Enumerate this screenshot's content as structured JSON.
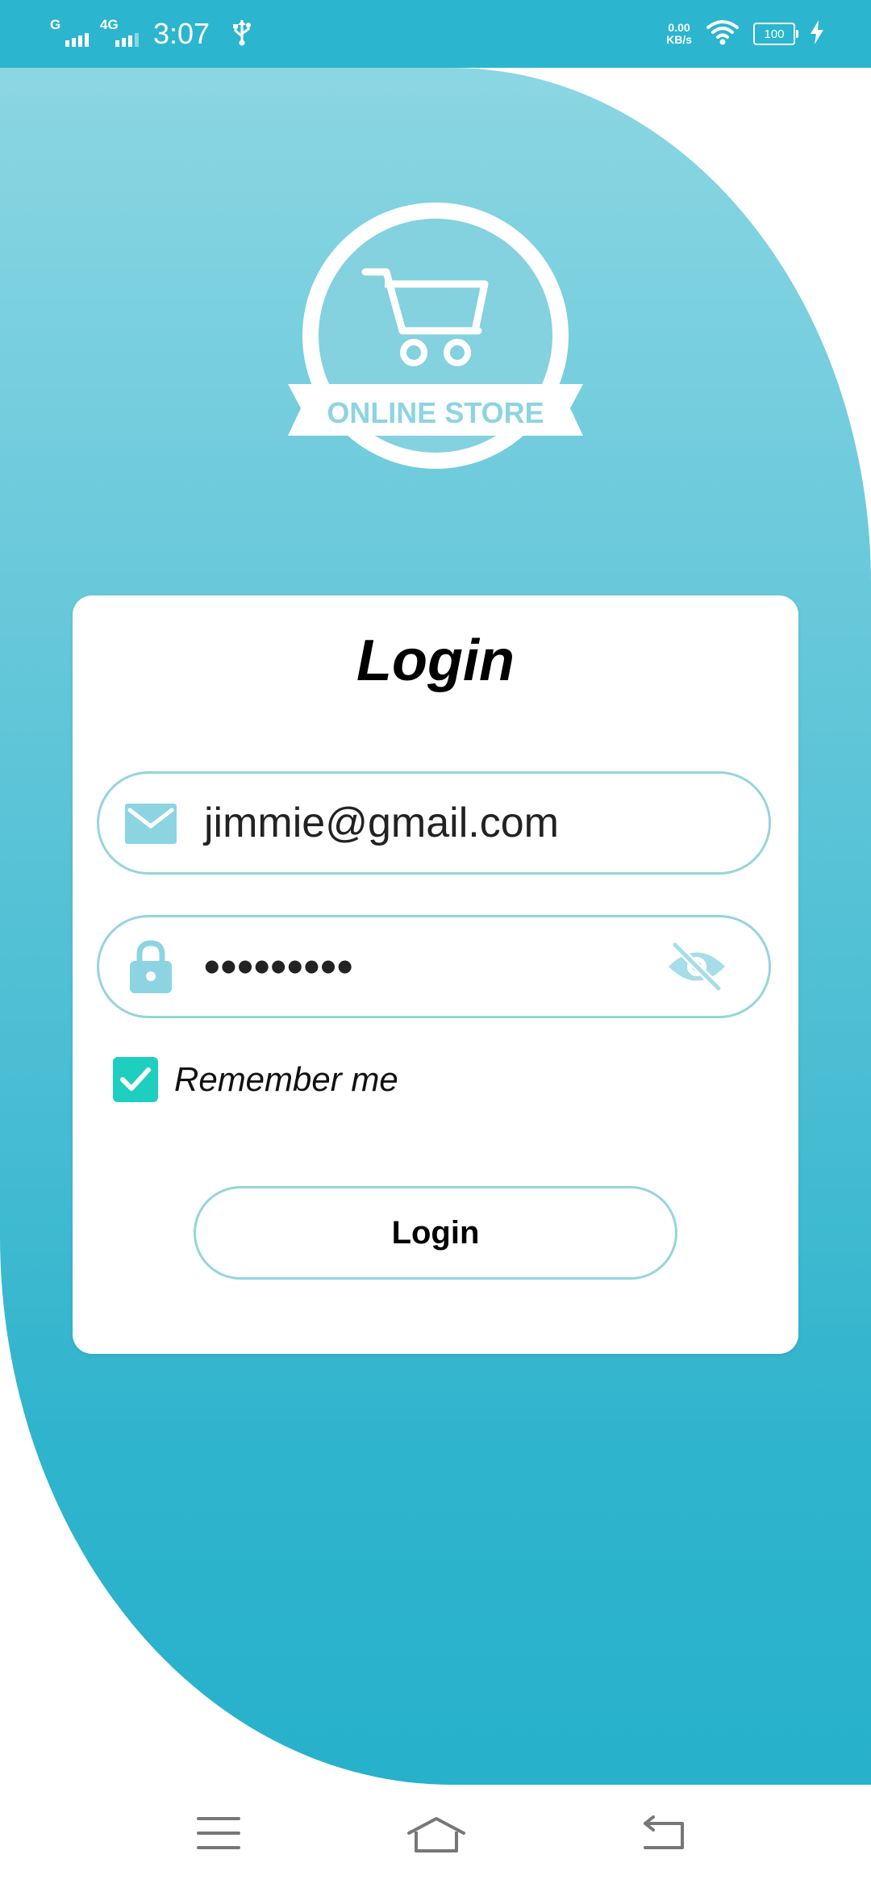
{
  "status_bar": {
    "signal1_label": "G",
    "signal2_label": "4G",
    "time": "3:07",
    "net_speed_value": "0.00",
    "net_speed_unit": "KB/s",
    "battery_level": "100",
    "icons": [
      "signal-icon",
      "usb-icon",
      "wifi-icon",
      "battery-icon",
      "charging-icon"
    ]
  },
  "logo": {
    "text": "ONLINE STORE",
    "icon": "shopping-cart-icon"
  },
  "login_card": {
    "title": "Login",
    "email": {
      "value": "jimmie@gmail.com",
      "icon": "mail-icon"
    },
    "password": {
      "value": "•••••••••",
      "icon": "lock-icon",
      "toggle_icon": "eye-off-icon"
    },
    "remember_me": {
      "label": "Remember me",
      "checked": true
    },
    "login_button": "Login"
  },
  "navigation_bar": {
    "buttons": [
      "menu-icon",
      "home-icon",
      "back-icon"
    ]
  },
  "colors": {
    "status_bar": "#2bb5ce",
    "gradient_top": "#8bd6e2",
    "gradient_bottom": "#28b1cb",
    "field_border": "#96d4df",
    "checkbox": "#1ecfc0",
    "icon_tint": "#8dd4e2"
  }
}
